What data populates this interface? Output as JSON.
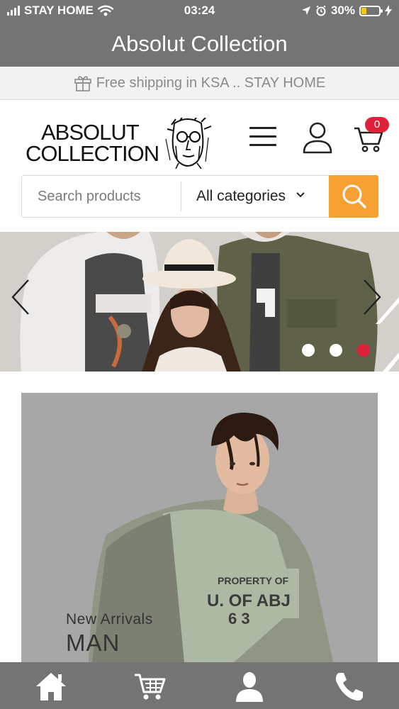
{
  "status_bar": {
    "carrier": "STAY HOME",
    "time": "03:24",
    "battery_percent": "30%",
    "battery_level": 0.3,
    "battery_color": "#f5c518",
    "icons": [
      "signal-icon",
      "wifi-icon",
      "location-icon",
      "alarm-icon",
      "battery-icon",
      "charging-icon"
    ]
  },
  "app_bar": {
    "title": "Absolut Collection"
  },
  "shipping_banner": {
    "icon": "gift-icon",
    "text": "Free shipping in KSA .. STAY HOME"
  },
  "header": {
    "logo": {
      "line1": "ABSOLUT",
      "line2": "COLLECTION"
    },
    "menu_icon": "hamburger-icon",
    "account_icon": "user-icon",
    "cart_icon": "cart-icon",
    "cart_count": "0",
    "badge_color": "#e0213a"
  },
  "search": {
    "placeholder": "Search products",
    "category": "All categories",
    "button_icon": "search-icon",
    "button_color": "#f7a135"
  },
  "hero_slider": {
    "prev_icon": "chevron-left-icon",
    "next_icon": "chevron-right-icon",
    "slide_count": 3,
    "active_slide": 3,
    "active_dot_color": "#e0213a"
  },
  "category_card": {
    "kicker": "New Arrivals",
    "title": "MAN"
  },
  "bottom_nav": {
    "items": [
      "home-icon",
      "cart-icon",
      "user-icon",
      "phone-icon"
    ]
  }
}
